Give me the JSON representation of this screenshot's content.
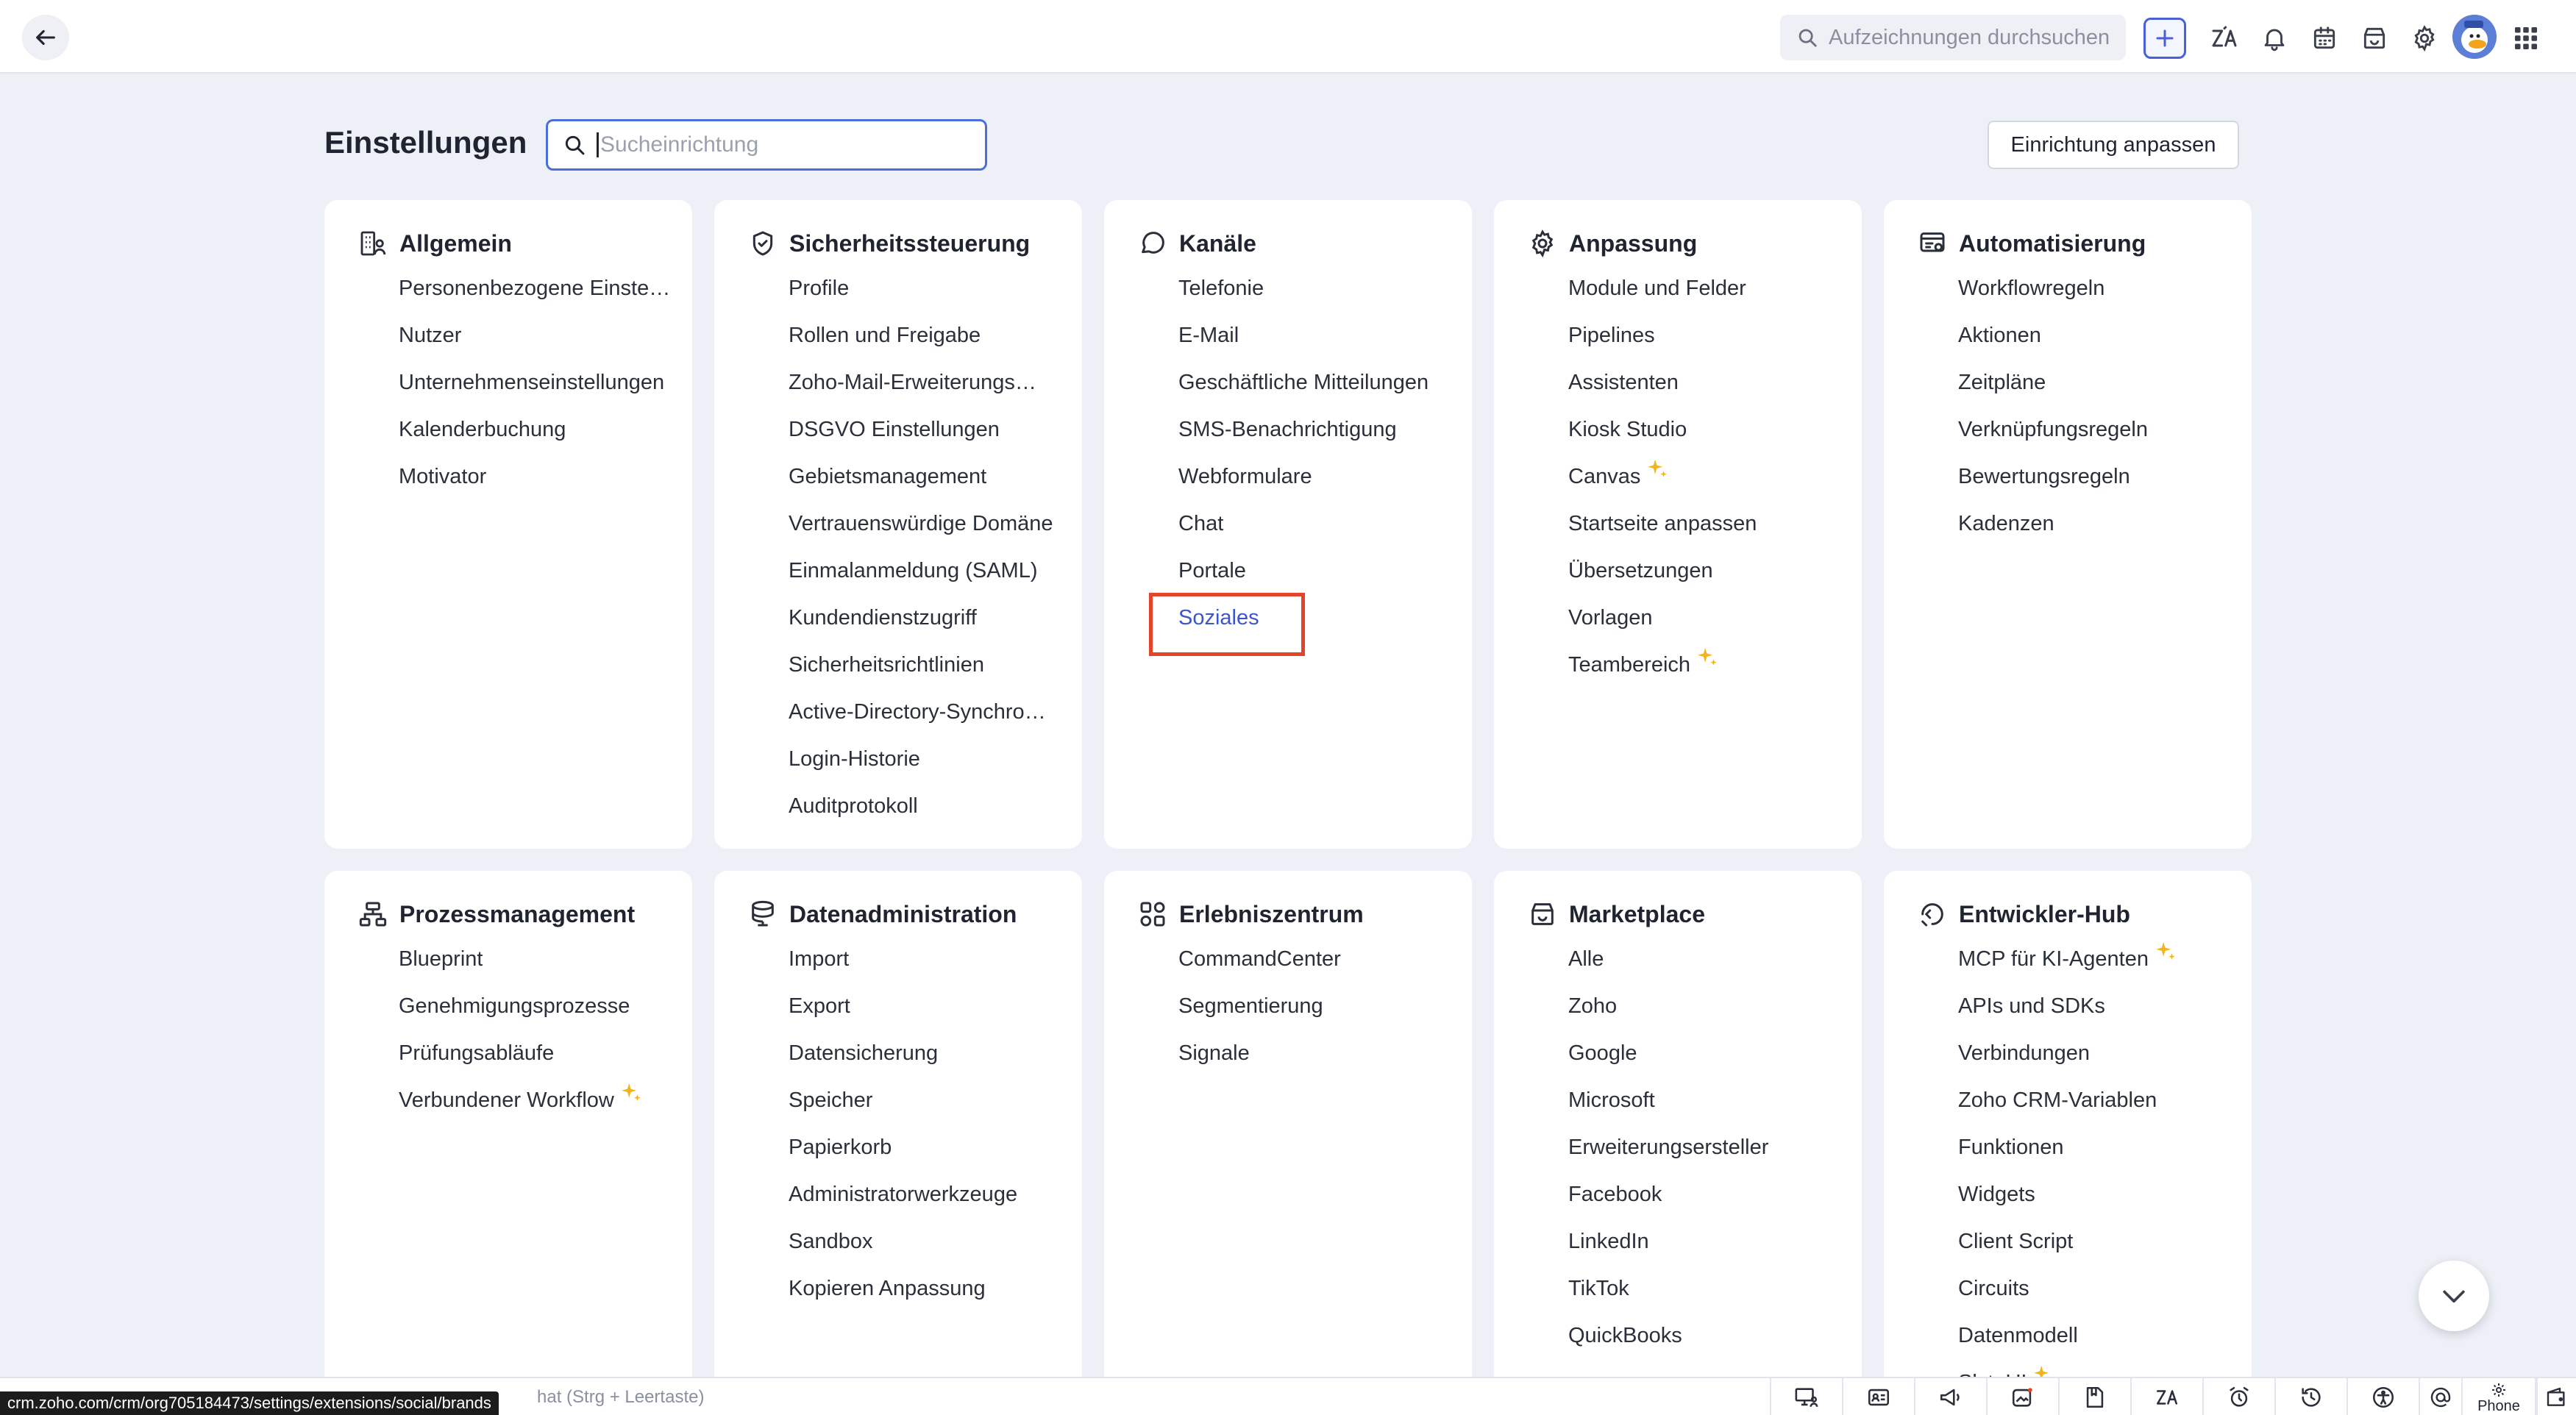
{
  "topbar": {
    "search_placeholder": "Aufzeichnungen durchsuchen"
  },
  "page": {
    "title": "Einstellungen",
    "search_placeholder": "Sucheinrichtung",
    "customize_button": "Einrichtung anpassen"
  },
  "cards": [
    {
      "title": "Allgemein",
      "icon": "building-user-icon",
      "items": [
        "Personenbezogene Einstellungen",
        "Nutzer",
        "Unternehmenseinstellungen",
        "Kalenderbuchung",
        "Motivator"
      ]
    },
    {
      "title": "Sicherheitssteuerung",
      "icon": "shield-check-icon",
      "items": [
        "Profile",
        "Rollen und Freigabe",
        "Zoho-Mail-Erweiterungsnutzer",
        "DSGVO Einstellungen",
        "Gebietsmanagement",
        "Vertrauenswürdige Domäne",
        "Einmalanmeldung (SAML)",
        "Kundendienstzugriff",
        "Sicherheitsrichtlinien",
        "Active-Directory-Synchronisation",
        "Login-Historie",
        "Auditprotokoll"
      ]
    },
    {
      "title": "Kanäle",
      "icon": "chat-bubble-icon",
      "items": [
        "Telefonie",
        "E-Mail",
        "Geschäftliche Mitteilungen",
        "SMS-Benachrichtigung",
        "Webformulare",
        "Chat",
        "Portale",
        "Soziales"
      ],
      "active_item": "Soziales"
    },
    {
      "title": "Anpassung",
      "icon": "gear-icon",
      "items": [
        "Module und Felder",
        "Pipelines",
        "Assistenten",
        "Kiosk Studio",
        "Canvas",
        "Startseite anpassen",
        "Übersetzungen",
        "Vorlagen",
        "Teambereich"
      ],
      "sparkle_items": [
        "Canvas",
        "Teambereich"
      ]
    },
    {
      "title": "Automatisierung",
      "icon": "automation-icon",
      "items": [
        "Workflowregeln",
        "Aktionen",
        "Zeitpläne",
        "Verknüpfungsregeln",
        "Bewertungsregeln",
        "Kadenzen"
      ]
    },
    {
      "title": "Prozessmanagement",
      "icon": "process-flow-icon",
      "items": [
        "Blueprint",
        "Genehmigungsprozesse",
        "Prüfungsabläufe",
        "Verbundener Workflow"
      ],
      "sparkle_items": [
        "Verbundener Workflow"
      ]
    },
    {
      "title": "Datenadministration",
      "icon": "database-icon",
      "items": [
        "Import",
        "Export",
        "Datensicherung",
        "Speicher",
        "Papierkorb",
        "Administratorwerkzeuge",
        "Sandbox",
        "Kopieren Anpassung"
      ]
    },
    {
      "title": "Erlebniszentrum",
      "icon": "experience-grid-icon",
      "items": [
        "CommandCenter",
        "Segmentierung",
        "Signale"
      ]
    },
    {
      "title": "Marketplace",
      "icon": "storefront-icon",
      "items": [
        "Alle",
        "Zoho",
        "Google",
        "Microsoft",
        "Erweiterungsersteller",
        "Facebook",
        "LinkedIn",
        "TikTok",
        "QuickBooks"
      ]
    },
    {
      "title": "Entwickler-Hub",
      "icon": "developer-hub-icon",
      "items": [
        "MCP für KI-Agenten",
        "APIs und SDKs",
        "Verbindungen",
        "Zoho CRM-Variablen",
        "Funktionen",
        "Widgets",
        "Client Script",
        "Circuits",
        "Datenmodell",
        "SlyteUI"
      ],
      "sparkle_items": [
        "MCP für KI-Agenten",
        "SlyteUI"
      ]
    }
  ],
  "bottombar": {
    "chat_hint": "hat (Strg + Leertaste)",
    "phone_label": "Phone",
    "icons": [
      "monitor-user-icon",
      "id-card-icon",
      "megaphone-icon",
      "ai-image-icon",
      "bookmark-note-icon",
      "zia-icon",
      "alarm-clock-icon",
      "history-icon",
      "accessibility-icon",
      "at-sign-icon",
      "phone-gear-icon",
      "wallet-icon"
    ]
  },
  "status_url": "crm.zoho.com/crm/org705184473/settings/extensions/social/brands",
  "colors": {
    "accent": "#3b55cc",
    "highlight": "#e5442a",
    "sparkle": "#f2b51b"
  }
}
